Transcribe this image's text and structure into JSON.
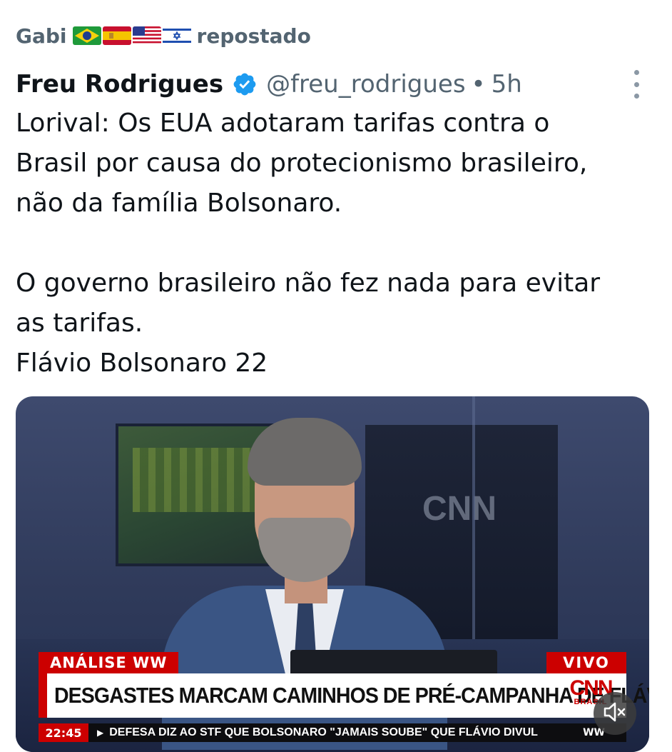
{
  "repost": {
    "user": "Gabi",
    "flags": [
      "brazil-flag",
      "spain-flag",
      "usa-flag",
      "israel-flag"
    ],
    "label": "repostado"
  },
  "tweet": {
    "author_name": "Freu Rodrigues",
    "handle": "@freu_rodrigues",
    "separator": "•",
    "time": "5h",
    "text_lines_1": [
      "Lorival: Os EUA adotaram tarifas contra o",
      "Brasil por causa do protecionismo brasileiro,",
      "não da família Bolsonaro."
    ],
    "text_lines_2": [
      "O governo brasileiro não fez nada para evitar",
      "as tarifas.",
      "Flávio Bolsonaro 22"
    ]
  },
  "video": {
    "tag_left": "ANÁLISE WW",
    "tag_right": "VIVO",
    "headline": "DESGASTES MARCAM CAMINHOS DE PRÉ-CAMPANHA DE FLÁVIO",
    "logo_text": "CNN",
    "logo_sub": "BRASIL",
    "ticker_time": "22:45",
    "ticker_text": "DEFESA DIZ AO STF QUE BOLSONARO \"JAMAIS SOUBE\" QUE FLÁVIO DIVUL",
    "ticker_end": "WW",
    "mute_icon": "muted-speaker-icon"
  },
  "colors": {
    "verified": "#1d9bf0",
    "muted_text": "#536471",
    "cnn_red": "#cc0000"
  }
}
